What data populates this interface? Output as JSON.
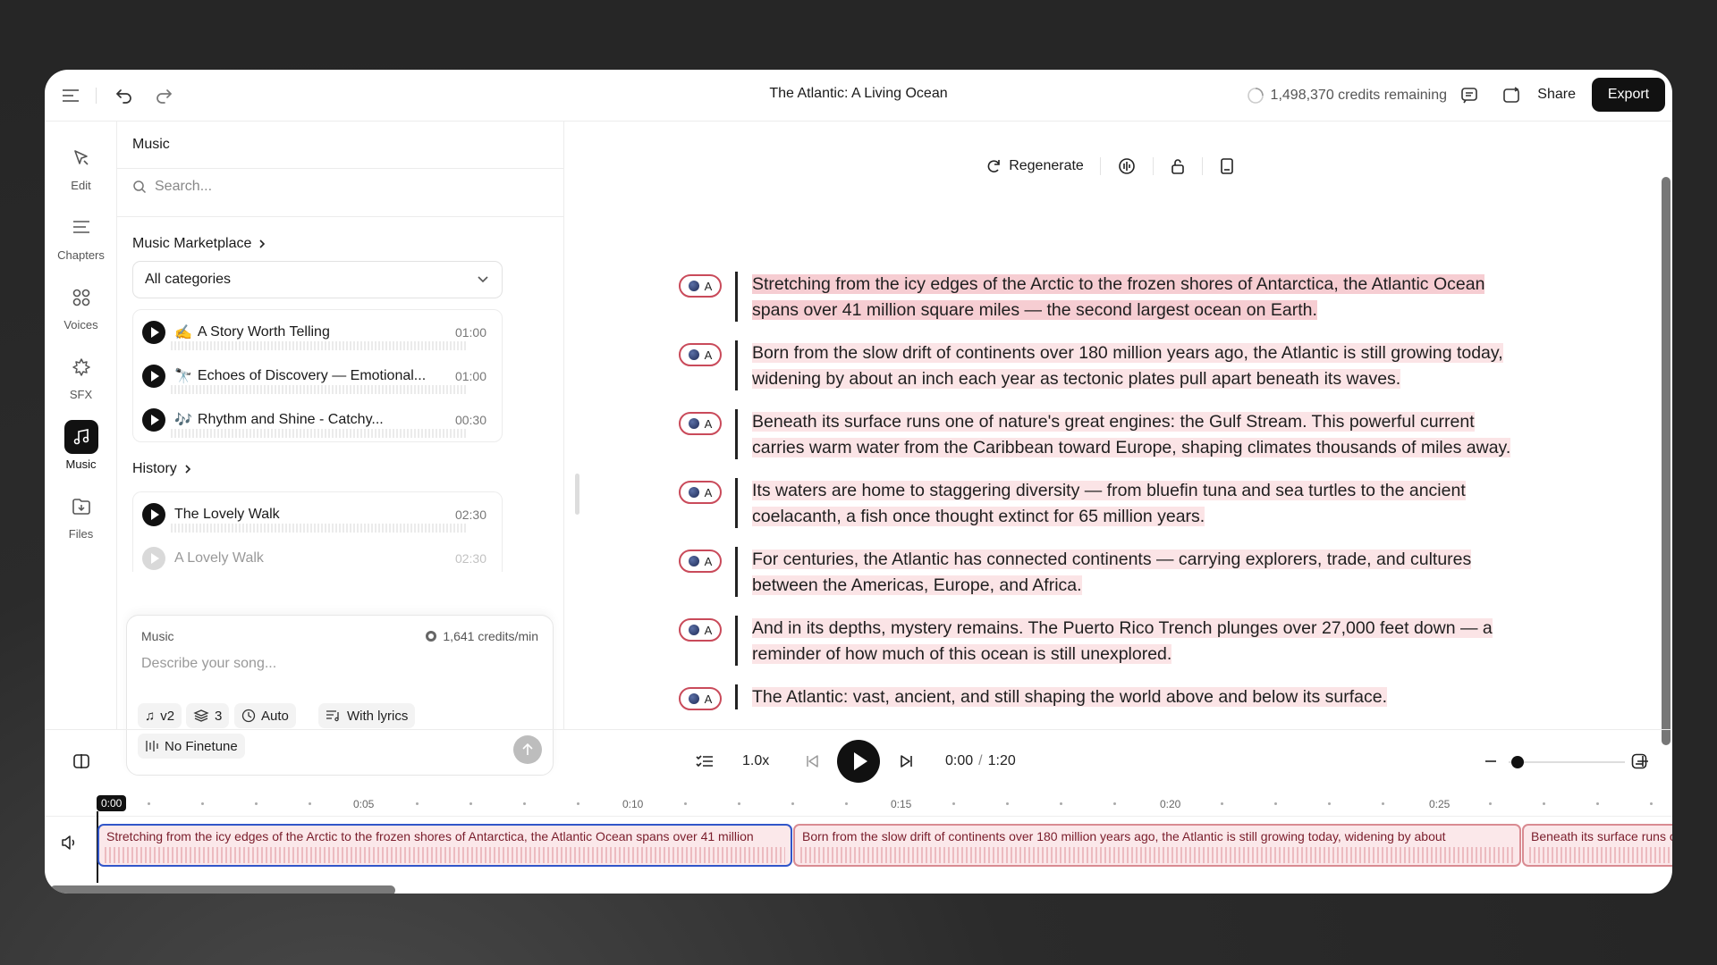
{
  "topbar": {
    "title": "The Atlantic: A Living Ocean",
    "credits": "1,498,370 credits remaining",
    "share_label": "Share",
    "export_label": "Export"
  },
  "nav": {
    "items": [
      {
        "label": "Edit",
        "icon": "edit-icon"
      },
      {
        "label": "Chapters",
        "icon": "chapters-icon"
      },
      {
        "label": "Voices",
        "icon": "voices-icon"
      },
      {
        "label": "SFX",
        "icon": "sfx-icon"
      },
      {
        "label": "Music",
        "icon": "music-icon",
        "active": true
      },
      {
        "label": "Files",
        "icon": "files-icon"
      }
    ]
  },
  "panel": {
    "heading": "Music",
    "search_placeholder": "Search...",
    "marketplace_label": "Music Marketplace",
    "category_select": "All categories",
    "tracks": [
      {
        "emoji": "✍️",
        "title": "A Story Worth Telling",
        "duration": "01:00"
      },
      {
        "emoji": "🔭",
        "title": "Echoes of Discovery — Emotional...",
        "duration": "01:00"
      },
      {
        "emoji": "🎶",
        "title": "Rhythm and Shine - Catchy...",
        "duration": "00:30"
      }
    ],
    "history_label": "History",
    "history": [
      {
        "title": "The Lovely Walk",
        "duration": "02:30"
      },
      {
        "title": "A Lovely Walk",
        "duration": "02:30"
      }
    ],
    "compose": {
      "label": "Music",
      "credits": "1,641 credits/min",
      "placeholder": "Describe your song...",
      "chips": {
        "model": "v2",
        "count": "3",
        "length": "Auto",
        "lyrics": "With lyrics",
        "finetune": "No Finetune"
      }
    }
  },
  "editor": {
    "regenerate_label": "Regenerate",
    "speaker_label": "A",
    "paragraphs": [
      {
        "line1": "Stretching from the icy edges of the Arctic to the frozen shores of Antarctica, the Atlantic Ocean",
        "line2": "spans over 41 million square miles — the second largest ocean on Earth."
      },
      {
        "line1": "Born from the slow drift of continents over 180 million years ago, the Atlantic is still growing today,",
        "line2": "widening by about an inch each year as tectonic plates pull apart beneath its waves."
      },
      {
        "line1": "Beneath its surface runs one of nature's great engines: the Gulf Stream. This powerful current",
        "line2": "carries warm water from the Caribbean toward Europe, shaping climates thousands of miles away."
      },
      {
        "line1": "Its waters are home to staggering diversity — from bluefin tuna and sea turtles to the ancient",
        "line2": "coelacanth, a fish once thought extinct for 65 million years."
      },
      {
        "line1": "For centuries, the Atlantic has connected continents — carrying explorers, trade, and cultures",
        "line2": "between the Americas, Europe, and Africa."
      },
      {
        "line1": "And in its depths, mystery remains. The Puerto Rico Trench plunges over 27,000 feet down — a",
        "line2": "reminder of how much of this ocean is still unexplored."
      },
      {
        "line1": "The Atlantic: vast, ancient, and still shaping the world above and below its surface.",
        "line2": ""
      }
    ]
  },
  "transport": {
    "speed": "1.0x",
    "current_time": "0:00",
    "time_separator": "/",
    "total_time": "1:20",
    "zoom_level": 0.04
  },
  "timeline": {
    "playhead": "0:00",
    "ticks": [
      "0:05",
      "0:10",
      "0:15",
      "0:20",
      "0:25"
    ],
    "clips": [
      "Stretching from the icy edges of the Arctic to the frozen shores of Antarctica, the Atlantic Ocean spans over 41 million",
      "Born from the slow drift of continents over 180 million years ago, the Atlantic is still growing today, widening by about",
      "Beneath its surface runs one of nature's great engines"
    ]
  },
  "colors": {
    "accent": "#111111",
    "highlight": "#fbe4e6",
    "speaker_ring": "#c94a5a",
    "selected_clip": "#3156c9"
  }
}
